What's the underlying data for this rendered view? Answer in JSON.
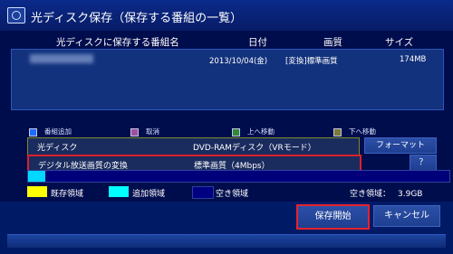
{
  "title": "光ディスク保存（保存する番組の一覧）",
  "headers": {
    "name": "光ディスクに保存する番組名",
    "date": "日付",
    "quality": "画質",
    "size": "サイズ"
  },
  "programs": [
    {
      "date": "2013/10/04(金)",
      "quality": "[変換]標準画質",
      "size": "174MB"
    }
  ],
  "legend": [
    {
      "label": "番組追加",
      "color": "#1e6cff"
    },
    {
      "label": "取消",
      "color": "#a04fa0"
    },
    {
      "label": "上へ移動",
      "color": "#2f8a3a"
    },
    {
      "label": "下へ移動",
      "color": "#7a7a3a"
    }
  ],
  "disc": {
    "label": "光ディスク",
    "value": "DVD-RAMディスク（VRモード）",
    "button": "フォーマット"
  },
  "conversion": {
    "label": "デジタル放送画質の変換",
    "value": "標準画質（4Mbps）",
    "button": "？"
  },
  "usage": {
    "used_fraction": 0.04
  },
  "usage_legend": [
    {
      "label": "既存領域",
      "color": "#ffff00"
    },
    {
      "label": "追加領域",
      "color": "#00ffff"
    },
    {
      "label": "空き領域",
      "color": "#000080"
    }
  ],
  "free_label": "空き領域：",
  "free_value": "3.9GB",
  "start_label": "保存開始",
  "cancel_label": "キャンセル"
}
